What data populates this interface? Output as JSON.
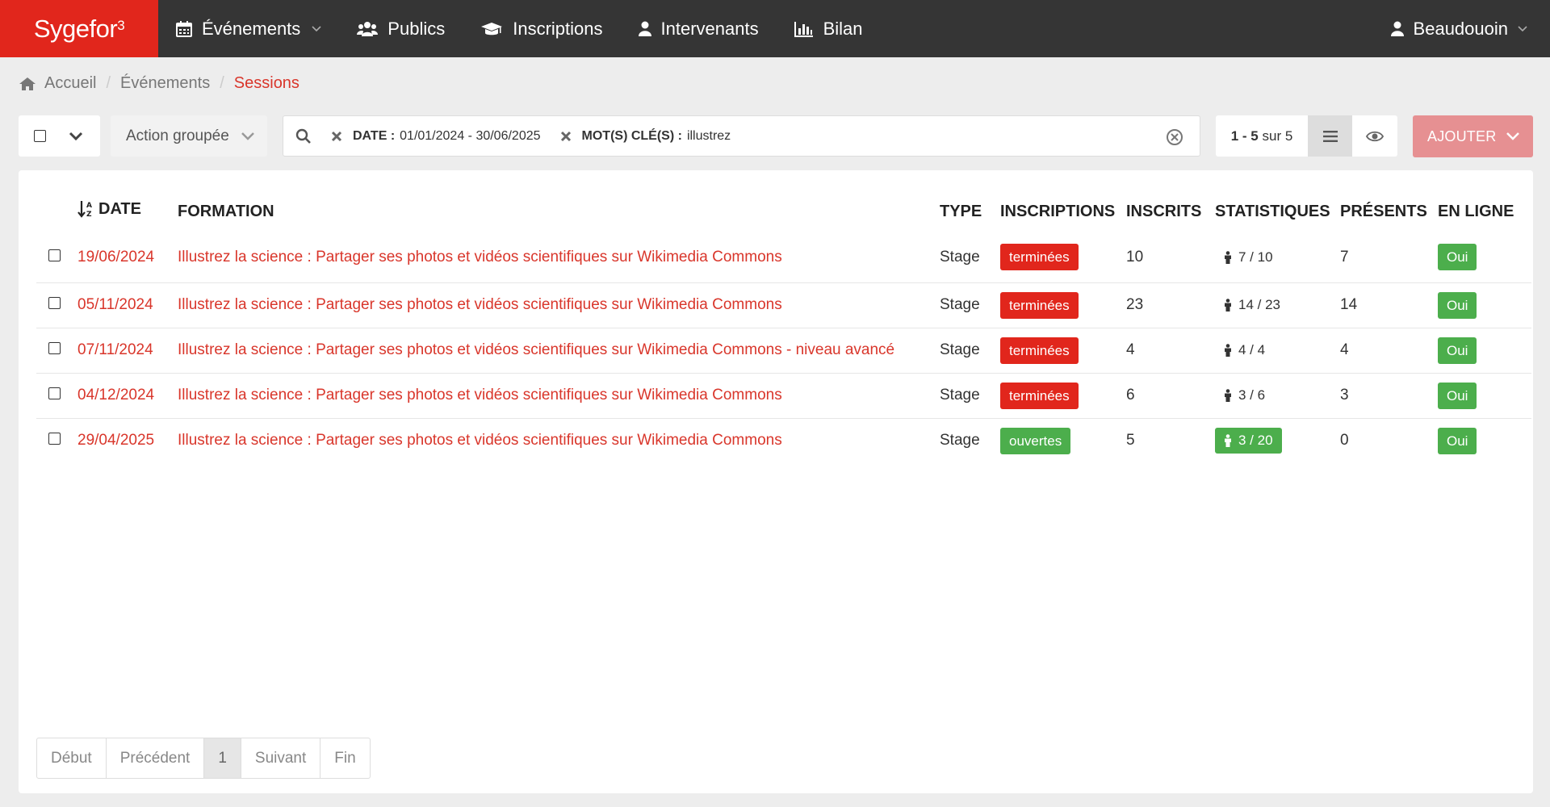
{
  "brand": {
    "name": "Sygefor",
    "sup": "3"
  },
  "nav": [
    {
      "label": "Événements",
      "icon": "calendar-icon",
      "has_caret": true
    },
    {
      "label": "Publics",
      "icon": "users-icon",
      "has_caret": false
    },
    {
      "label": "Inscriptions",
      "icon": "graduation-cap-icon",
      "has_caret": false
    },
    {
      "label": "Intervenants",
      "icon": "user-icon",
      "has_caret": false
    },
    {
      "label": "Bilan",
      "icon": "bar-chart-icon",
      "has_caret": false
    }
  ],
  "user": {
    "name": "Beaudouoin"
  },
  "breadcrumb": [
    {
      "label": "Accueil"
    },
    {
      "label": "Événements"
    },
    {
      "label": "Sessions"
    }
  ],
  "toolbar": {
    "action_label": "Action groupée",
    "filters": [
      {
        "key": "DATE :",
        "value": "01/01/2024 - 30/06/2025"
      },
      {
        "key": "MOT(S) CLÉ(S) :",
        "value": "illustrez"
      }
    ],
    "count_range": "1 - 5",
    "count_suffix": "sur 5",
    "add_label": "AJOUTER"
  },
  "table": {
    "headers": {
      "date": "DATE",
      "formation": "FORMATION",
      "type": "TYPE",
      "inscriptions": "INSCRIPTIONS",
      "inscrits": "INSCRITS",
      "statistiques": "STATISTIQUES",
      "presents": "PRÉSENTS",
      "en_ligne": "EN LIGNE"
    },
    "rows": [
      {
        "date": "19/06/2024",
        "formation": "Illustrez la science : Partager ses photos et vidéos scientifiques sur Wikimedia Commons",
        "type": "Stage",
        "inscriptions": "terminées",
        "inscriptions_status": "done",
        "inscrits": "10",
        "stat": "7 / 10",
        "stat_highlight": false,
        "presents": "7",
        "en_ligne": "Oui"
      },
      {
        "date": "05/11/2024",
        "formation": "Illustrez la science : Partager ses photos et vidéos scientifiques sur Wikimedia Commons",
        "type": "Stage",
        "inscriptions": "terminées",
        "inscriptions_status": "done",
        "inscrits": "23",
        "stat": "14 / 23",
        "stat_highlight": false,
        "presents": "14",
        "en_ligne": "Oui"
      },
      {
        "date": "07/11/2024",
        "formation": "Illustrez la science : Partager ses photos et vidéos scientifiques sur Wikimedia Commons - niveau avancé",
        "type": "Stage",
        "inscriptions": "terminées",
        "inscriptions_status": "done",
        "inscrits": "4",
        "stat": "4 / 4",
        "stat_highlight": false,
        "presents": "4",
        "en_ligne": "Oui"
      },
      {
        "date": "04/12/2024",
        "formation": "Illustrez la science : Partager ses photos et vidéos scientifiques sur Wikimedia Commons",
        "type": "Stage",
        "inscriptions": "terminées",
        "inscriptions_status": "done",
        "inscrits": "6",
        "stat": "3 / 6",
        "stat_highlight": false,
        "presents": "3",
        "en_ligne": "Oui"
      },
      {
        "date": "29/04/2025",
        "formation": "Illustrez la science : Partager ses photos et vidéos scientifiques sur Wikimedia Commons",
        "type": "Stage",
        "inscriptions": "ouvertes",
        "inscriptions_status": "open",
        "inscrits": "5",
        "stat": "3 / 20",
        "stat_highlight": true,
        "presents": "0",
        "en_ligne": "Oui"
      }
    ]
  },
  "pagination": {
    "first": "Début",
    "prev": "Précédent",
    "current": "1",
    "next": "Suivant",
    "last": "Fin"
  },
  "colors": {
    "brand": "#e1261c",
    "topbar": "#353535",
    "link": "#d9362b",
    "success": "#4cae4c",
    "add_button": "#e69092"
  }
}
